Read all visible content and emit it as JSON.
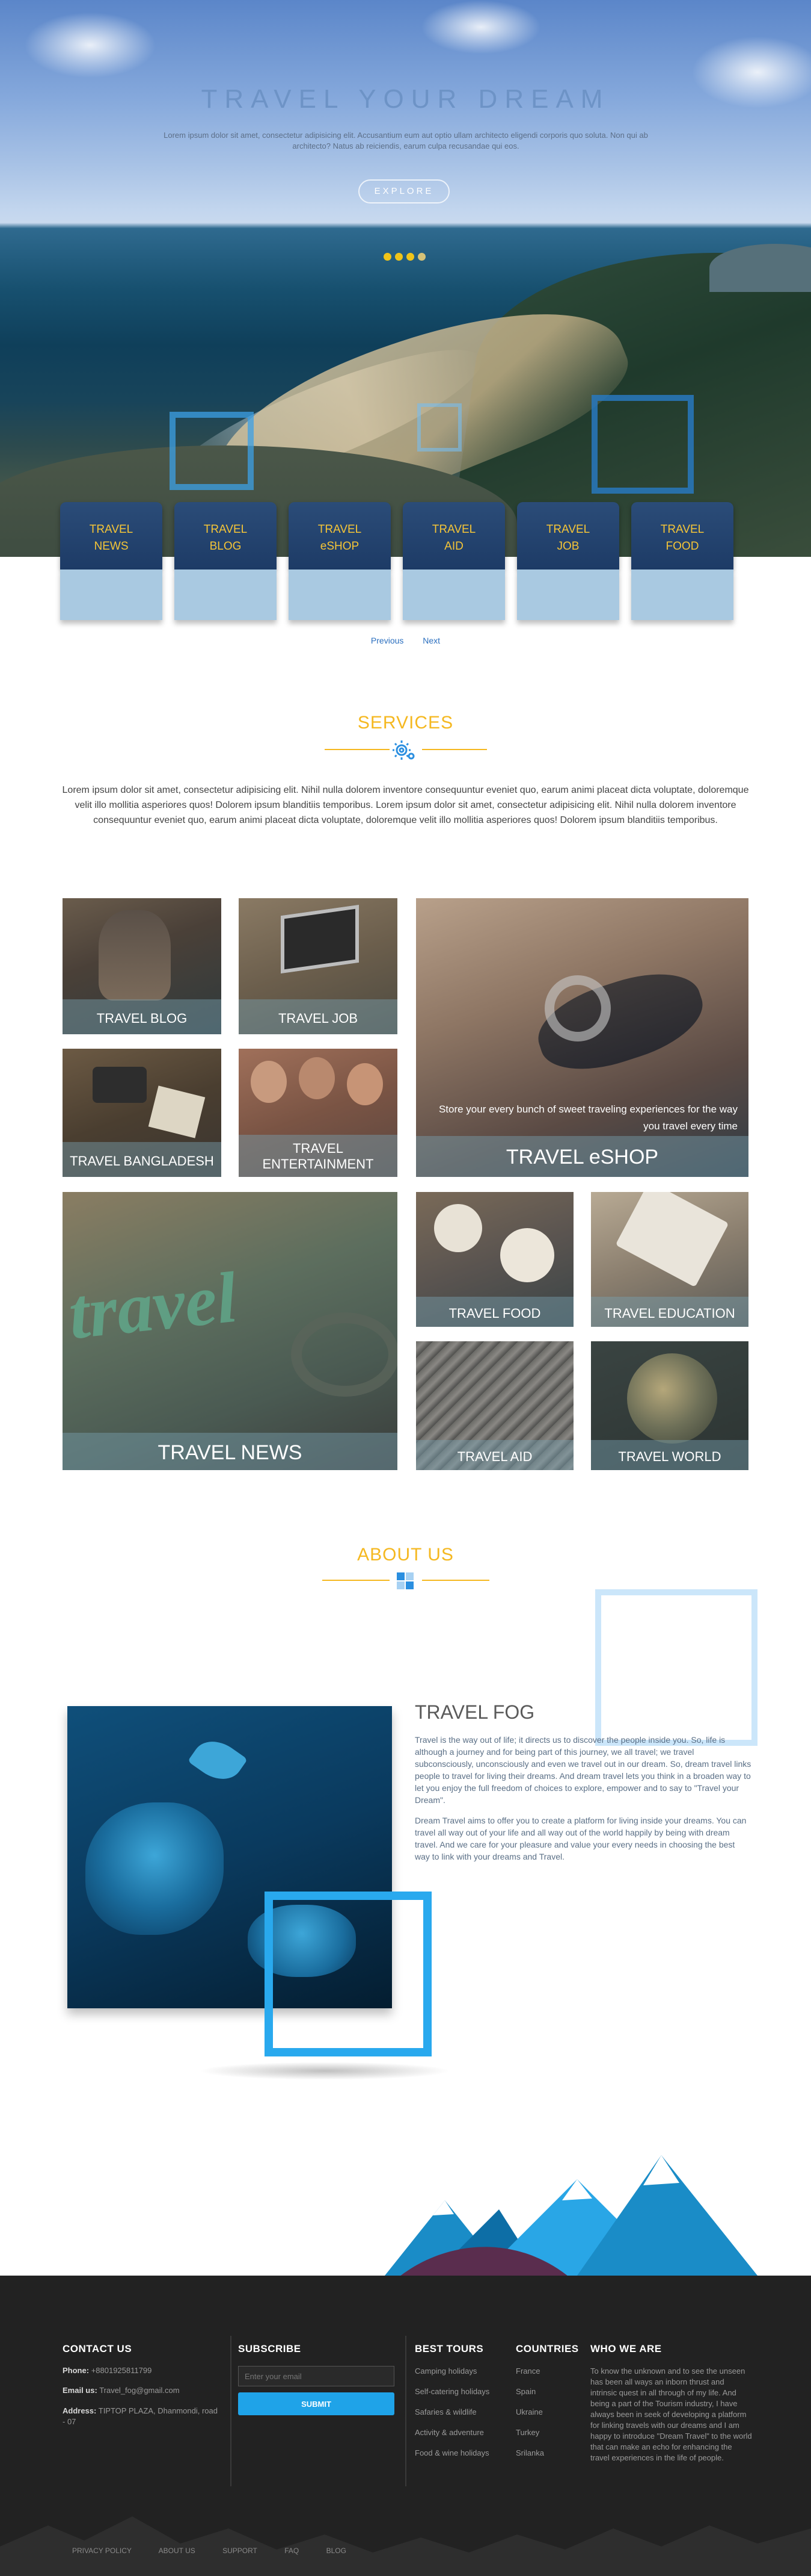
{
  "hero": {
    "title": "TRAVEL YOUR DREAM",
    "text": "Lorem ipsum dolor sit amet, consectetur adipisicing elit. Accusantium eum aut optio ullam architecto eligendi corporis quo soluta. Non qui ab architecto? Natus ab reiciendis, earum culpa recusandae qui eos.",
    "explore": "EXPLORE"
  },
  "categories": [
    {
      "line1": "TRAVEL",
      "line2": "NEWS"
    },
    {
      "line1": "TRAVEL",
      "line2": "BLOG"
    },
    {
      "line1": "TRAVEL",
      "line2": "eSHOP"
    },
    {
      "line1": "TRAVEL",
      "line2": "AID"
    },
    {
      "line1": "TRAVEL",
      "line2": "JOB"
    },
    {
      "line1": "TRAVEL",
      "line2": "FOOD"
    }
  ],
  "pager": {
    "previous": "Previous",
    "next": "Next"
  },
  "services": {
    "title": "SERVICES",
    "text": "Lorem ipsum dolor sit amet, consectetur adipisicing elit. Nihil nulla dolorem inventore consequuntur eveniet quo, earum animi placeat dicta voluptate, doloremque velit illo mollitia asperiores quos! Dolorem ipsum blanditiis temporibus. Lorem ipsum dolor sit amet, consectetur adipisicing elit. Nihil nulla dolorem inventore consequuntur eveniet quo, earum animi placeat dicta voluptate, doloremque velit illo mollitia asperiores quos! Dolorem ipsum blanditiis temporibus."
  },
  "gallery": {
    "blog": "TRAVEL BLOG",
    "job": "TRAVEL JOB",
    "bangladesh": "TRAVEL BANGLADESH",
    "entertainment_1": "TRAVEL",
    "entertainment_2": "ENTERTAINMENT",
    "eshop_caption_1": "Store your every bunch of sweet traveling experiences for the way",
    "eshop_caption_2": "you travel every time",
    "eshop": "TRAVEL eSHOP",
    "news": "TRAVEL NEWS",
    "food": "TRAVEL FOOD",
    "education": "TRAVEL EDUCATION",
    "aid": "TRAVEL AID",
    "world": "TRAVEL WORLD"
  },
  "about": {
    "title": "ABOUT US",
    "heading": "TRAVEL FOG",
    "p1": "Travel is the way out of life; it directs us to discover the people inside you. So, life is although a journey and for being part of this journey, we all travel; we travel subconsciously, unconsciously and even we travel out in our dream. So, dream travel links people to travel for living their dreams. And dream travel lets you think in a broaden way to let you enjoy the full freedom of choices to explore, empower and to say to \"Travel your Dream\".",
    "p2": "Dream Travel aims to offer you to create a platform for living inside your dreams. You can travel all way out of your life and all way out of the world happily by being with dream travel. And we care for your pleasure and value your every needs in choosing the best way to link with your dreams and Travel."
  },
  "footer": {
    "contact": {
      "title": "CONTACT US",
      "phone_label": "Phone:",
      "phone": "+8801925811799",
      "email_label": "Email us:",
      "email": "Travel_fog@gmail.com",
      "address_label": "Address:",
      "address": "TIPTOP PLAZA, Dhanmondi, road - 07"
    },
    "subscribe": {
      "title": "SUBSCRIBE",
      "placeholder": "Enter your email",
      "button": "SUBMIT"
    },
    "tours": {
      "title": "BEST TOURS",
      "items": [
        "Camping holidays",
        "Self-catering holidays",
        "Safaries & wildlife",
        "Activity & adventure",
        "Food & wine holidays"
      ]
    },
    "countries": {
      "title": "COUNTRIES",
      "items": [
        "France",
        "Spain",
        "Ukraine",
        "Turkey",
        "Srilanka"
      ]
    },
    "who": {
      "title": "WHO WE ARE",
      "text": "To know the unknown and to see the unseen has been all ways an inborn thrust and intrinsic quest in all through of my life. And being a part of the Tourism industry, I have always been in seek of developing a platform for linking travels with our dreams and I am happy to introduce \"Dream Travel\" to the world that can make an echo for enhancing the travel experiences in the life of people."
    },
    "links": [
      "PRIVACY POLICY",
      "ABOUT US",
      "SUPPORT",
      "FAQ",
      "BLOG"
    ]
  },
  "colors": {
    "accent": "#f5b820",
    "brand_blue": "#1fa3e8",
    "nav_blue": "#1d3b66"
  }
}
